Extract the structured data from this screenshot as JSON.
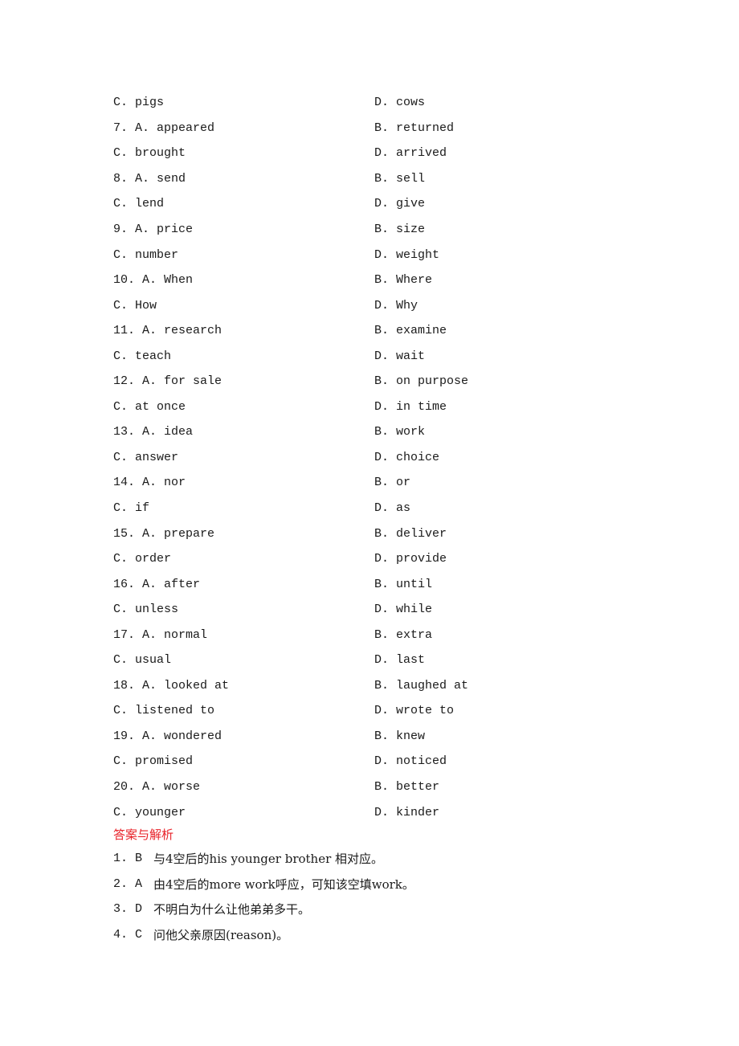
{
  "options": [
    {
      "left": "C. pigs",
      "right": "D. cows"
    },
    {
      "left": "7. A. appeared",
      "right": "B. returned"
    },
    {
      "left": "C. brought",
      "right": "D. arrived"
    },
    {
      "left": "8. A. send",
      "right": "B. sell"
    },
    {
      "left": "C. lend",
      "right": "D. give"
    },
    {
      "left": "9. A. price",
      "right": "B. size"
    },
    {
      "left": "C. number",
      "right": "D. weight"
    },
    {
      "left": "10. A. When",
      "right": "B. Where"
    },
    {
      "left": "C. How",
      "right": "D. Why"
    },
    {
      "left": "11. A. research",
      "right": "B. examine"
    },
    {
      "left": "C. teach",
      "right": "D. wait"
    },
    {
      "left": "12. A. for sale",
      "right": "B. on purpose"
    },
    {
      "left": "C. at once",
      "right": "D. in time"
    },
    {
      "left": "13. A. idea",
      "right": "B. work"
    },
    {
      "left": "C. answer",
      "right": "D. choice"
    },
    {
      "left": "14. A. nor",
      "right": "B. or"
    },
    {
      "left": "C. if",
      "right": "D. as"
    },
    {
      "left": "15. A. prepare",
      "right": "B. deliver"
    },
    {
      "left": "C. order",
      "right": "D. provide"
    },
    {
      "left": "16. A. after",
      "right": "B. until"
    },
    {
      "left": "C. unless",
      "right": "D. while"
    },
    {
      "left": "17. A. normal",
      "right": "B. extra"
    },
    {
      "left": "C. usual",
      "right": "D. last"
    },
    {
      "left": "18. A. looked at",
      "right": "B. laughed at"
    },
    {
      "left": "C. listened to",
      "right": "D. wrote to"
    },
    {
      "left": "19. A. wondered",
      "right": "B. knew"
    },
    {
      "left": "C. promised",
      "right": "D. noticed"
    },
    {
      "left": "20. A. worse",
      "right": "B. better"
    },
    {
      "left": "C. younger",
      "right": "D. kinder"
    }
  ],
  "answers": {
    "title": "答案与解析",
    "items": [
      {
        "num": "1. B",
        "text": "与4空后的his younger brother 相对应。"
      },
      {
        "num": "2. A",
        "text": "由4空后的more work呼应，可知该空填work。"
      },
      {
        "num": "3. D",
        "text": "不明白为什么让他弟弟多干。"
      },
      {
        "num": "4. C",
        "text": "问他父亲原因(reason)。"
      }
    ]
  },
  "colors": {
    "accent_title": "#e8232a",
    "text": "#1a1a1a"
  }
}
